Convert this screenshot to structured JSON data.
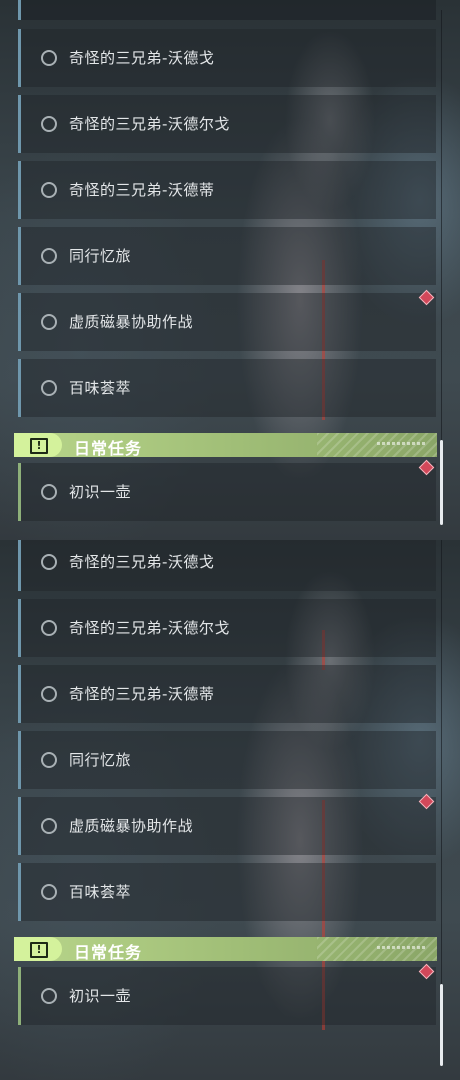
{
  "list_top": {
    "rows": [
      {
        "label": "奇怪的三兄弟-沃德戈"
      },
      {
        "label": "奇怪的三兄弟-沃德尔戈"
      },
      {
        "label": "奇怪的三兄弟-沃德蒂"
      },
      {
        "label": "同行忆旅"
      },
      {
        "label": "虚质磁暴协助作战"
      },
      {
        "label": "百味荟萃"
      }
    ],
    "section": {
      "title": "日常任务",
      "icon": "exclamation-icon"
    },
    "daily_rows": [
      {
        "label": "初识一壶"
      }
    ]
  },
  "list_bottom": {
    "rows": [
      {
        "label": "奇怪的三兄弟-沃德戈"
      },
      {
        "label": "奇怪的三兄弟-沃德尔戈"
      },
      {
        "label": "奇怪的三兄弟-沃德蒂"
      },
      {
        "label": "同行忆旅"
      },
      {
        "label": "虚质磁暴协助作战"
      },
      {
        "label": "百味荟萃"
      }
    ],
    "section": {
      "title": "日常任务",
      "icon": "exclamation-icon"
    },
    "daily_rows": [
      {
        "label": "初识一壶"
      }
    ]
  },
  "colors": {
    "quest_accent": "#6f97ac",
    "daily_accent": "#b8d58a",
    "marker": "#d2485a"
  }
}
